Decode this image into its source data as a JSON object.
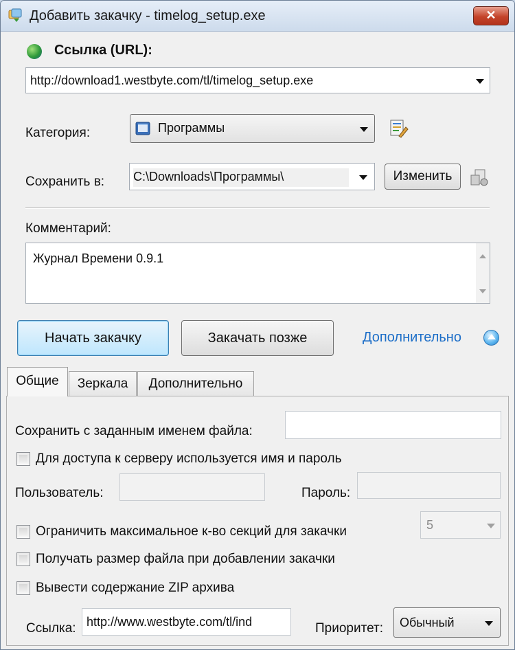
{
  "window": {
    "title": "Добавить закачку - timelog_setup.exe",
    "close_label": "✕"
  },
  "url": {
    "label": "Ссылка (URL):",
    "value": "http://download1.westbyte.com/tl/timelog_setup.exe"
  },
  "category": {
    "label": "Категория:",
    "value": "Программы"
  },
  "save_to": {
    "label": "Сохранить в:",
    "value": "C:\\Downloads\\Программы\\",
    "change_button": "Изменить"
  },
  "comment": {
    "label": "Комментарий:",
    "value": "Журнал Времени 0.9.1"
  },
  "actions": {
    "start": "Начать закачку",
    "later": "Закачать позже",
    "more": "Дополнительно"
  },
  "tabs": [
    {
      "label": "Общие"
    },
    {
      "label": "Зеркала"
    },
    {
      "label": "Дополнительно"
    }
  ],
  "general": {
    "save_name_label": "Сохранить с заданным именем файла:",
    "save_name_value": "",
    "auth_checkbox": "Для доступа к серверу используется имя и пароль",
    "user_label": "Пользователь:",
    "password_label": "Пароль:",
    "limit_sections_checkbox": "Ограничить максимальное к-во секций для закачки",
    "sections_value": "5",
    "get_size_checkbox": "Получать размер файла при добавлении закачки",
    "zip_checkbox": "Вывести содержание ZIP архива",
    "referer_label": "Ссылка:",
    "referer_value": "http://www.westbyte.com/tl/ind",
    "priority_label": "Приоритет:",
    "priority_value": "Обычный"
  },
  "colors": {
    "link": "#1e6fc8",
    "close_button": "#c4442a"
  }
}
